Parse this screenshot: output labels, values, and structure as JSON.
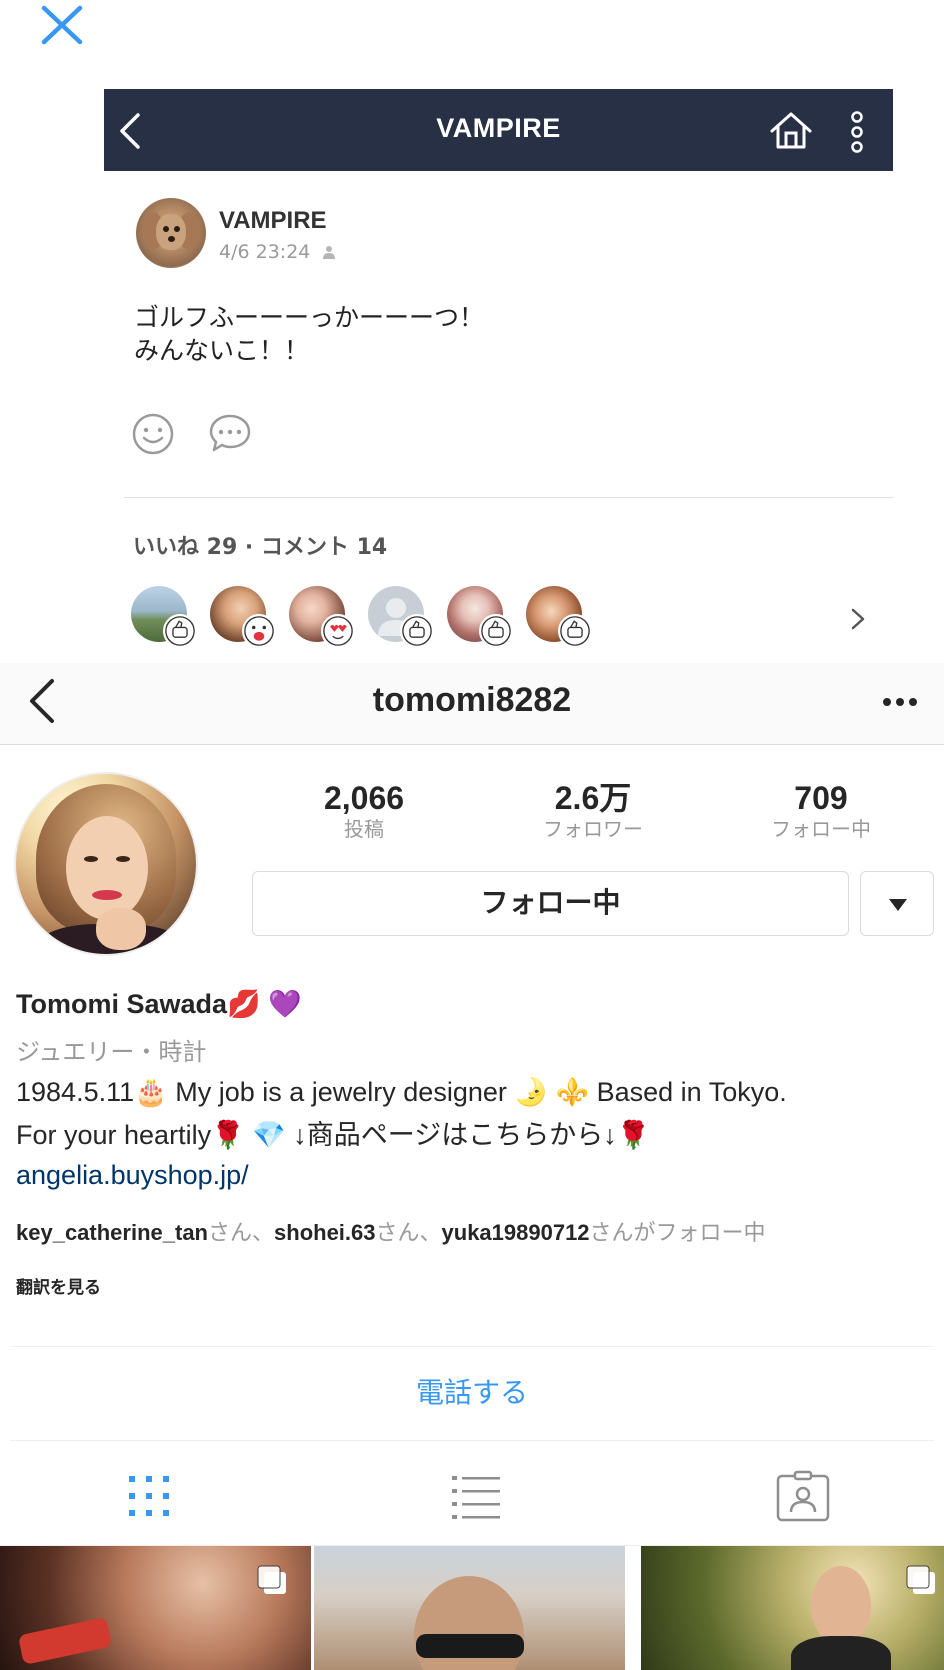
{
  "colors": {
    "line_header_bg": "#283046",
    "ig_link": "#003569",
    "ig_blue": "#3897f0",
    "close_x": "#3897f0"
  },
  "top": {
    "close_icon": "close-icon"
  },
  "line_post": {
    "header_title": "VAMPIRE",
    "author": "VAMPIRE",
    "timestamp": "4/6 23:24",
    "body": "ゴルフふーーーっかーーーつ！\nみんないこ！！",
    "stats": "いいね 29 · コメント 14",
    "reactions": [
      "thumbs-up-sticker",
      "surprised-sticker",
      "heart-eyes-sticker",
      "thumbs-up-sticker",
      "thumbs-up-sticker",
      "thumbs-up-sticker"
    ]
  },
  "profile": {
    "username": "tomomi8282",
    "stats": [
      {
        "value": "2,066",
        "label": "投稿"
      },
      {
        "value": "2.6万",
        "label": "フォロワー"
      },
      {
        "value": "709",
        "label": "フォロー中"
      }
    ],
    "follow_label": "フォロー中",
    "full_name": "Tomomi Sawada💋 💜",
    "category": "ジュエリー・時計",
    "bio": "1984.5.11🎂 My job is a jewelry designer 🌛 ⚜️ Based in Tokyo.\nFor your heartily🌹 💎  ↓商品ページはこちらから↓🌹",
    "link": "angelia.buyshop.jp/",
    "followed_by": {
      "user1": "key_catherine_tan",
      "sep1": "さん、",
      "user2": "shohei.63",
      "sep2": "さん、",
      "user3": "yuka19890712",
      "suffix": "さんがフォロー中"
    },
    "translate": "翻訳を見る",
    "call": "電話する"
  }
}
